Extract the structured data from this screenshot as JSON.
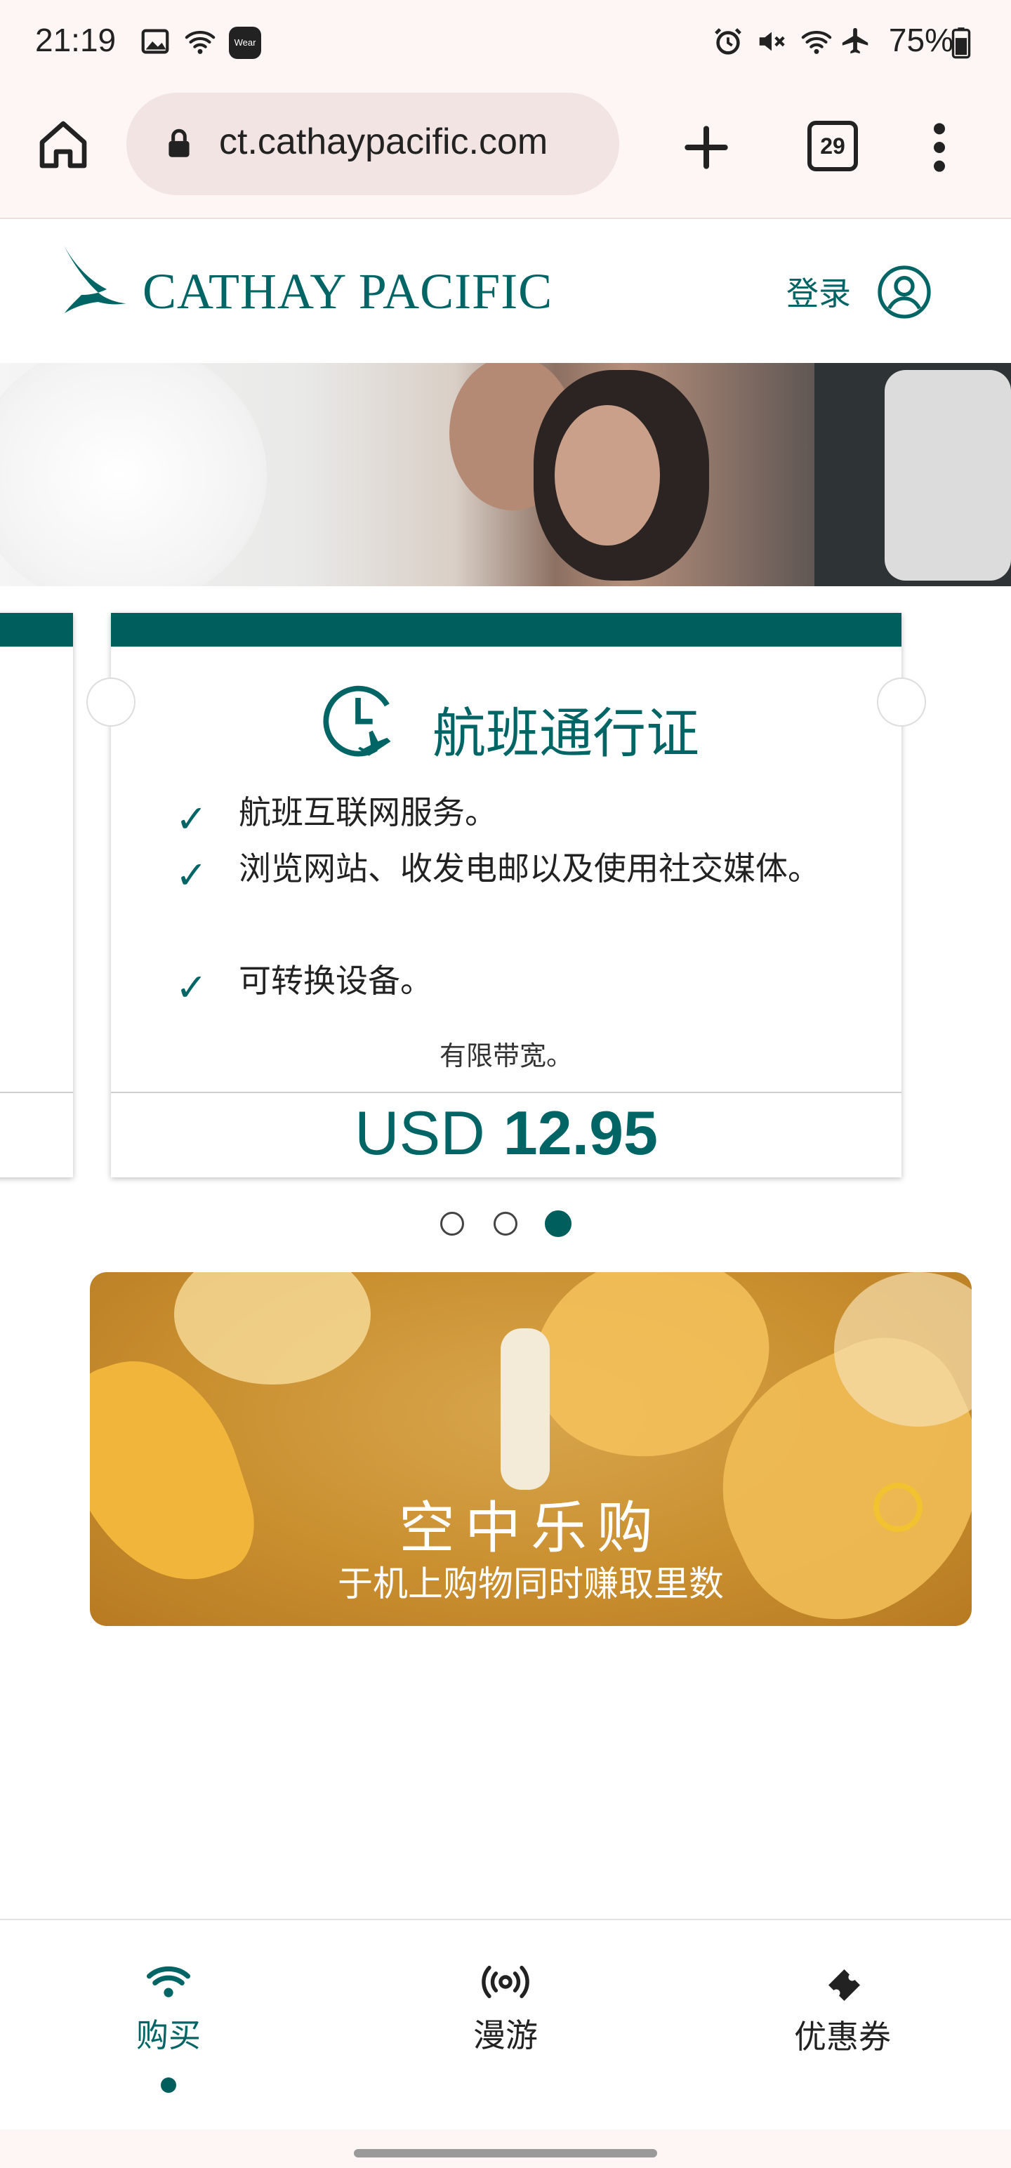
{
  "status_bar": {
    "time": "21:19",
    "battery": "75%",
    "icons": [
      "image-icon",
      "wifi-icon",
      "wear-icon",
      "alarm-icon",
      "mute-icon",
      "wifi-icon",
      "airplane-icon",
      "battery-icon"
    ],
    "wear_label": "Wear"
  },
  "browser": {
    "url": "ct.cathaypacific.com",
    "tab_count": "29"
  },
  "header": {
    "brand": "CATHAY PACIFIC",
    "login": "登录"
  },
  "card": {
    "title": "航班通行证",
    "features": [
      "航班互联网服务。",
      "浏览网站、收发电邮以及使用社交媒体。",
      "可转换设备。"
    ],
    "note": "有限带宽。",
    "price_currency": "USD",
    "price_value": "12.95"
  },
  "carousel": {
    "dots": 3,
    "active_index": 2
  },
  "promo": {
    "title": "空中乐购",
    "subtitle": "于机上购物同时赚取里数"
  },
  "bottom_nav": {
    "items": [
      {
        "label": "购买",
        "icon": "wifi-icon",
        "active": true
      },
      {
        "label": "漫游",
        "icon": "roaming-icon",
        "active": false
      },
      {
        "label": "优惠券",
        "icon": "voucher-icon",
        "active": false
      }
    ]
  },
  "colors": {
    "brand": "#006564",
    "card_top": "#005e5d",
    "chrome_bg": "#fdf6f4"
  }
}
